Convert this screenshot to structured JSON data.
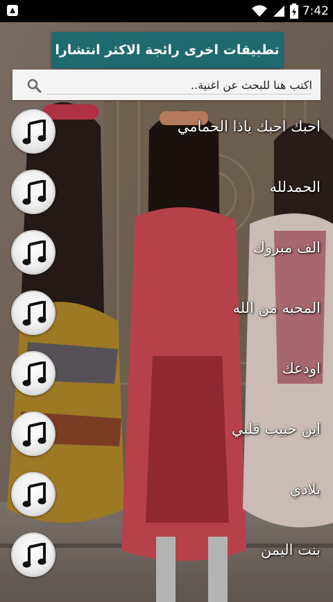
{
  "status_bar": {
    "time": "7:42",
    "icons": [
      "notification-icon",
      "wifi-icon",
      "signal-icon",
      "battery-icon"
    ]
  },
  "header": {
    "banner_label": "تطبيقات اخرى رائجة الاكثر انتشارا"
  },
  "search": {
    "placeholder": "اكتب هنا للبحث عن اغنية..",
    "icon": "search-icon"
  },
  "songs": [
    {
      "title": "احبك احبك ياذا الحمامي",
      "icon": "music-note-icon"
    },
    {
      "title": "الحمدلله",
      "icon": "music-note-icon"
    },
    {
      "title": "الف مبروك",
      "icon": "music-note-icon"
    },
    {
      "title": "المحبه من الله",
      "icon": "music-note-icon"
    },
    {
      "title": "اودعك",
      "icon": "music-note-icon"
    },
    {
      "title": "اين حبيب قلبي",
      "icon": "music-note-icon"
    },
    {
      "title": "بلادي",
      "icon": "music-note-icon"
    },
    {
      "title": "بنت اليمن",
      "icon": "music-note-icon"
    }
  ],
  "colors": {
    "banner_bg": "#1f6a6f",
    "status_bar_bg": "#000000"
  }
}
